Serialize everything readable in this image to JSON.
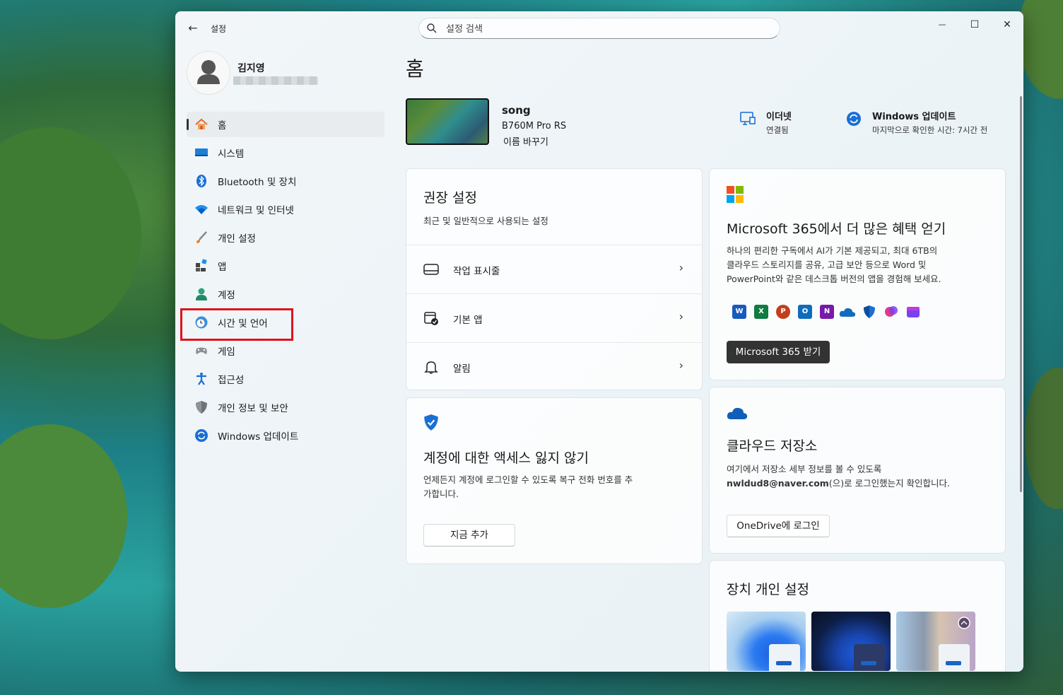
{
  "titlebar": {
    "app_title": "설정",
    "back_symbol": "←",
    "minimize": "—",
    "maximize": "☐",
    "close": "✕"
  },
  "search": {
    "placeholder": "설정 검색"
  },
  "profile": {
    "name": "김지영"
  },
  "nav": [
    {
      "label": "홈",
      "icon": "home-icon",
      "active": true
    },
    {
      "label": "시스템",
      "icon": "system-icon"
    },
    {
      "label": "Bluetooth 및 장치",
      "icon": "bluetooth-icon"
    },
    {
      "label": "네트워크 및 인터넷",
      "icon": "network-icon"
    },
    {
      "label": "개인 설정",
      "icon": "brush-icon"
    },
    {
      "label": "앱",
      "icon": "apps-icon"
    },
    {
      "label": "계정",
      "icon": "account-icon"
    },
    {
      "label": "시간 및 언어",
      "icon": "time-language-icon",
      "highlighted": true
    },
    {
      "label": "게임",
      "icon": "gamepad-icon"
    },
    {
      "label": "접근성",
      "icon": "accessibility-icon"
    },
    {
      "label": "개인 정보 및 보안",
      "icon": "shield-icon"
    },
    {
      "label": "Windows 업데이트",
      "icon": "update-icon"
    }
  ],
  "main": {
    "title": "홈",
    "device": {
      "name": "song",
      "model": "B760M Pro RS",
      "rename": "이름 바꾸기"
    },
    "ethernet": {
      "title": "이더넷",
      "status": "연결됨"
    },
    "update": {
      "title": "Windows 업데이트",
      "status": "마지막으로 확인한 시간: 7시간 전"
    }
  },
  "recommended": {
    "title": "권장 설정",
    "subtitle": "최근 및 일반적으로 사용되는 설정",
    "items": [
      {
        "label": "작업 표시줄",
        "icon": "taskbar-icon"
      },
      {
        "label": "기본 앱",
        "icon": "default-apps-icon"
      },
      {
        "label": "알림",
        "icon": "bell-icon"
      }
    ],
    "chevron": "›"
  },
  "account_card": {
    "title": "계정에 대한 액세스 잃지 않기",
    "body_line1": "언제든지 계정에 로그인할 수 있도록 복구 전화 번호를 추",
    "body_line2": "가합니다.",
    "button": "지금 추가"
  },
  "m365": {
    "title": "Microsoft 365에서 더 많은 혜택 얻기",
    "body_line1": "하나의 편리한 구독에서 AI가 기본 제공되고, 최대 6TB의",
    "body_line2": "클라우드 스토리지를 공유, 고급 보안 등으로 Word 및",
    "body_line3": "PowerPoint와 같은 데스크톱 버전의 앱을 경험해 보세요.",
    "button": "Microsoft 365 받기",
    "apps": [
      {
        "letter": "W",
        "color": "#185abd"
      },
      {
        "letter": "X",
        "color": "#107c41"
      },
      {
        "letter": "P",
        "color": "#c43e1c"
      },
      {
        "letter": "O",
        "color": "#0f6cbd"
      },
      {
        "letter": "N",
        "color": "#7719aa"
      }
    ]
  },
  "cloud": {
    "title": "클라우드 저장소",
    "body_line1": "여기에서 저장소 세부 정보를 볼 수 있도록",
    "email": "nwldud8@naver.com",
    "body_line2_rest": "(으)로 로그인했는지 확인합니다.",
    "button": "OneDrive에 로그인"
  },
  "personalize": {
    "title": "장치 개인 설정"
  },
  "colors": {
    "accent": "#0067c0",
    "highlight_border": "#e0121b"
  }
}
